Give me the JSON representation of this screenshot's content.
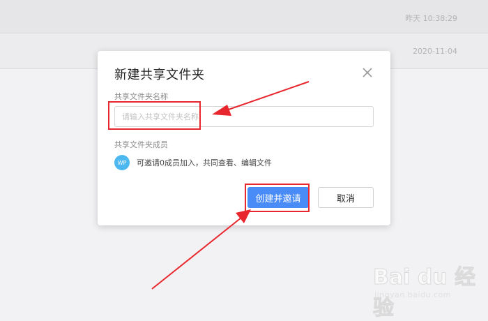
{
  "background_list": [
    {
      "time": "昨天 10:38:29"
    },
    {
      "time": "2020-11-04"
    }
  ],
  "dialog": {
    "title": "新建共享文件夹",
    "name_label": "共享文件夹名称",
    "name_placeholder": "请输入共享文件夹名称",
    "name_value": "",
    "members_label": "共享文件夹成员",
    "avatar_text": "WP",
    "invite_text": "可邀请0成员加入，共同查看、编辑文件",
    "create_button": "创建并邀请",
    "cancel_button": "取消"
  },
  "colors": {
    "primary": "#4a8cf7",
    "annotation": "#e8262d",
    "avatar": "#4db8f0"
  },
  "watermark": {
    "logo": "Bai du 经验",
    "url": "jingyan.baidu.com"
  }
}
